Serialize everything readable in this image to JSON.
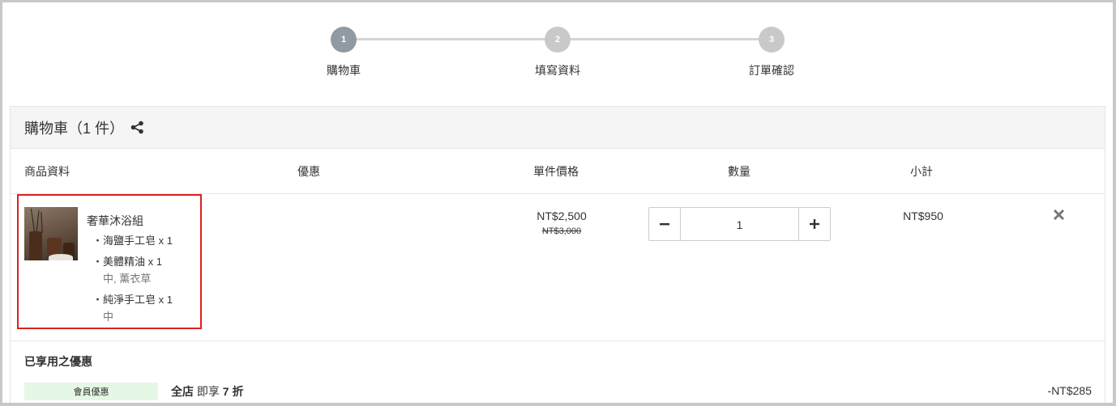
{
  "stepper": {
    "steps": [
      {
        "number": "1",
        "label": "購物車"
      },
      {
        "number": "2",
        "label": "填寫資料"
      },
      {
        "number": "3",
        "label": "訂單確認"
      }
    ]
  },
  "cart": {
    "title": "購物車（1 件）",
    "columns": {
      "product": "商品資料",
      "discount": "優惠",
      "unit_price": "單件價格",
      "quantity": "數量",
      "subtotal": "小計"
    },
    "item": {
      "name": "奢華沐浴組",
      "components": [
        {
          "label": "・海鹽手工皂 x 1",
          "note": ""
        },
        {
          "label": "・美體精油 x 1",
          "note": "中, 薰衣草"
        },
        {
          "label": "・純淨手工皂 x 1",
          "note": "中"
        }
      ],
      "price": "NT$2,500",
      "original_price": "NT$3,000",
      "quantity": "1",
      "subtotal": "NT$950"
    },
    "promotions": {
      "title": "已享用之優惠",
      "badge": "會員優惠",
      "desc_scope": "全店",
      "desc_text": " 即享 ",
      "desc_value": "7 折",
      "amount": "-NT$285"
    }
  }
}
